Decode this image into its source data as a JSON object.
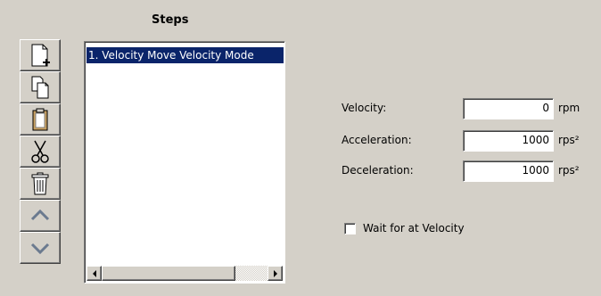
{
  "steps_title": "Steps",
  "toolbar": [
    {
      "name": "new-step-button",
      "icon": "new-page-icon"
    },
    {
      "name": "copy-step-button",
      "icon": "copy-icon"
    },
    {
      "name": "paste-step-button",
      "icon": "clipboard-icon"
    },
    {
      "name": "cut-step-button",
      "icon": "scissors-icon"
    },
    {
      "name": "delete-step-button",
      "icon": "trash-icon"
    },
    {
      "name": "move-up-button",
      "icon": "chevron-up-icon"
    },
    {
      "name": "move-down-button",
      "icon": "chevron-down-icon"
    }
  ],
  "steps_list": {
    "items": [
      "1. Velocity Move Velocity Mode"
    ],
    "selected_index": 0
  },
  "form": {
    "velocity": {
      "label": "Velocity:",
      "value": "0",
      "unit": "rpm"
    },
    "acceleration": {
      "label": "Acceleration:",
      "value": "1000",
      "unit": "rps²"
    },
    "deceleration": {
      "label": "Deceleration:",
      "value": "1000",
      "unit": "rps²"
    },
    "wait_checkbox": {
      "label": "Wait for at Velocity",
      "checked": false
    }
  },
  "colors": {
    "background": "#d4d0c8",
    "selection": "#0a246a"
  }
}
